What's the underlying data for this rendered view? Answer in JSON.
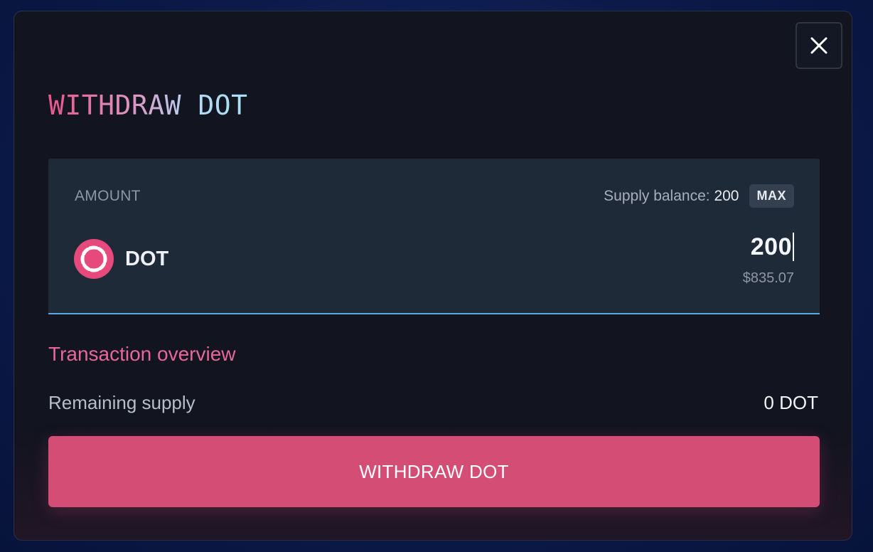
{
  "modal": {
    "title": "WITHDRAW DOT",
    "close_icon": "close-icon"
  },
  "amount": {
    "label": "AMOUNT",
    "supply_balance_label": "Supply balance:",
    "supply_balance_value": "200",
    "max_label": "MAX",
    "token": {
      "icon": "polkadot-icon",
      "symbol": "DOT",
      "icon_color": "#e6497b"
    },
    "input_value": "200",
    "usd_value": "$835.07"
  },
  "overview": {
    "title": "Transaction overview",
    "rows": [
      {
        "label": "Remaining supply",
        "value": "0 DOT"
      }
    ]
  },
  "submit": {
    "label": "WITHDRAW DOT",
    "color": "#d44d75"
  },
  "colors": {
    "accent_pink": "#e8679a",
    "input_border": "#5aa8e8"
  }
}
